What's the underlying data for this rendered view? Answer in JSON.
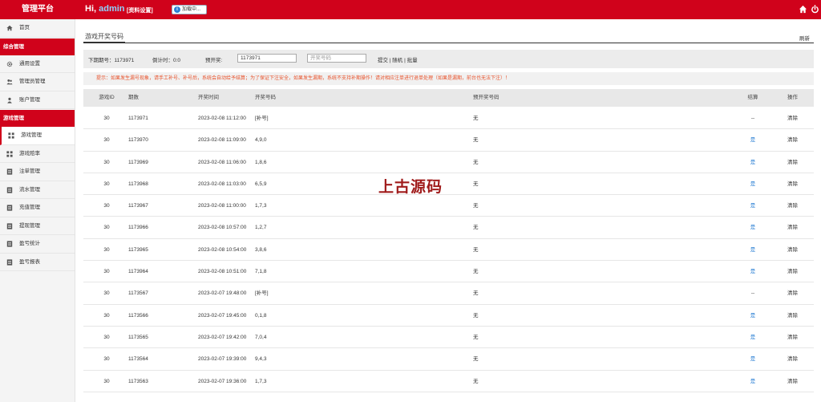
{
  "header": {
    "brand": "管理平台",
    "greeting": "Hi,",
    "username": "admin",
    "profile_link": "[资料设置]",
    "loading_text": "加载中...",
    "icons": [
      "info-icon",
      "home-icon",
      "power-icon"
    ]
  },
  "sidebar": {
    "items": [
      {
        "label": "首页",
        "icon": "home-icon"
      },
      {
        "section": "综合管理"
      },
      {
        "label": "通用设置",
        "icon": "gear-icon"
      },
      {
        "label": "管理员管理",
        "icon": "users-icon"
      },
      {
        "label": "账户管理",
        "icon": "user-icon"
      },
      {
        "section": "游戏管理"
      },
      {
        "label": "游戏管理",
        "icon": "grid-icon",
        "active": true
      },
      {
        "label": "游戏赔率",
        "icon": "grid-icon"
      },
      {
        "label": "注单管理",
        "icon": "list-icon"
      },
      {
        "label": "流水管理",
        "icon": "list-icon"
      },
      {
        "label": "充值管理",
        "icon": "list-icon"
      },
      {
        "label": "提现管理",
        "icon": "list-icon"
      },
      {
        "label": "盈亏统计",
        "icon": "list-icon"
      },
      {
        "label": "盈亏报表",
        "icon": "list-icon"
      }
    ]
  },
  "tab": {
    "title": "游戏开奖号码",
    "refresh": "刷新"
  },
  "filter": {
    "next_issue_label": "下期期号：1173971",
    "countdown_label": "倒计时：0:0",
    "preset_label": "预开奖:",
    "issue_value": "1173971",
    "number_placeholder": "开奖号码",
    "links": "提交 | 随机 | 批量"
  },
  "notice": "提示：如果发生漏号现象，请手工补号、补号后，系统会自动给予结算；为了保证下注安全，如果发生漏期，系统不支持补期操作！请对相应注单进行退单处理（如果是漏期，前台也无法下注）！",
  "table": {
    "columns": [
      "游戏ID",
      "期数",
      "开奖时间",
      "开奖号码",
      "预开奖号码",
      "结算",
      "操作"
    ],
    "rows": [
      {
        "id": "30",
        "issue": "1173971",
        "time": "2023-02-08 11:12:00",
        "number": "[补号]",
        "preset": "无",
        "pay": "--",
        "op": "清除"
      },
      {
        "id": "30",
        "issue": "1173970",
        "time": "2023-02-08 11:09:00",
        "number": "4,9,0",
        "preset": "无",
        "pay": "是",
        "op": "清除"
      },
      {
        "id": "30",
        "issue": "1173969",
        "time": "2023-02-08 11:06:00",
        "number": "1,8,6",
        "preset": "无",
        "pay": "是",
        "op": "清除"
      },
      {
        "id": "30",
        "issue": "1173968",
        "time": "2023-02-08 11:03:00",
        "number": "6,5,9",
        "preset": "无",
        "pay": "是",
        "op": "清除"
      },
      {
        "id": "30",
        "issue": "1173967",
        "time": "2023-02-08 11:00:00",
        "number": "1,7,3",
        "preset": "无",
        "pay": "是",
        "op": "清除"
      },
      {
        "id": "30",
        "issue": "1173966",
        "time": "2023-02-08 10:57:00",
        "number": "1,2,7",
        "preset": "无",
        "pay": "是",
        "op": "清除"
      },
      {
        "id": "30",
        "issue": "1173965",
        "time": "2023-02-08 10:54:00",
        "number": "3,8,6",
        "preset": "无",
        "pay": "是",
        "op": "清除"
      },
      {
        "id": "30",
        "issue": "1173964",
        "time": "2023-02-08 10:51:00",
        "number": "7,1,8",
        "preset": "无",
        "pay": "是",
        "op": "清除"
      },
      {
        "id": "30",
        "issue": "1173567",
        "time": "2023-02-07 19:48:00",
        "number": "[补号]",
        "preset": "无",
        "pay": "--",
        "op": "清除"
      },
      {
        "id": "30",
        "issue": "1173566",
        "time": "2023-02-07 19:45:00",
        "number": "0,1,8",
        "preset": "无",
        "pay": "是",
        "op": "清除"
      },
      {
        "id": "30",
        "issue": "1173565",
        "time": "2023-02-07 19:42:00",
        "number": "7,0,4",
        "preset": "无",
        "pay": "是",
        "op": "清除"
      },
      {
        "id": "30",
        "issue": "1173564",
        "time": "2023-02-07 19:39:00",
        "number": "9,4,3",
        "preset": "无",
        "pay": "是",
        "op": "清除"
      },
      {
        "id": "30",
        "issue": "1173563",
        "time": "2023-02-07 19:36:00",
        "number": "1,7,3",
        "preset": "无",
        "pay": "是",
        "op": "清除"
      }
    ]
  },
  "watermark": "上古源码",
  "colors": {
    "brand_red": "#d0021b",
    "link_blue": "#2a7fd4",
    "notice_orange": "#e8522b"
  }
}
